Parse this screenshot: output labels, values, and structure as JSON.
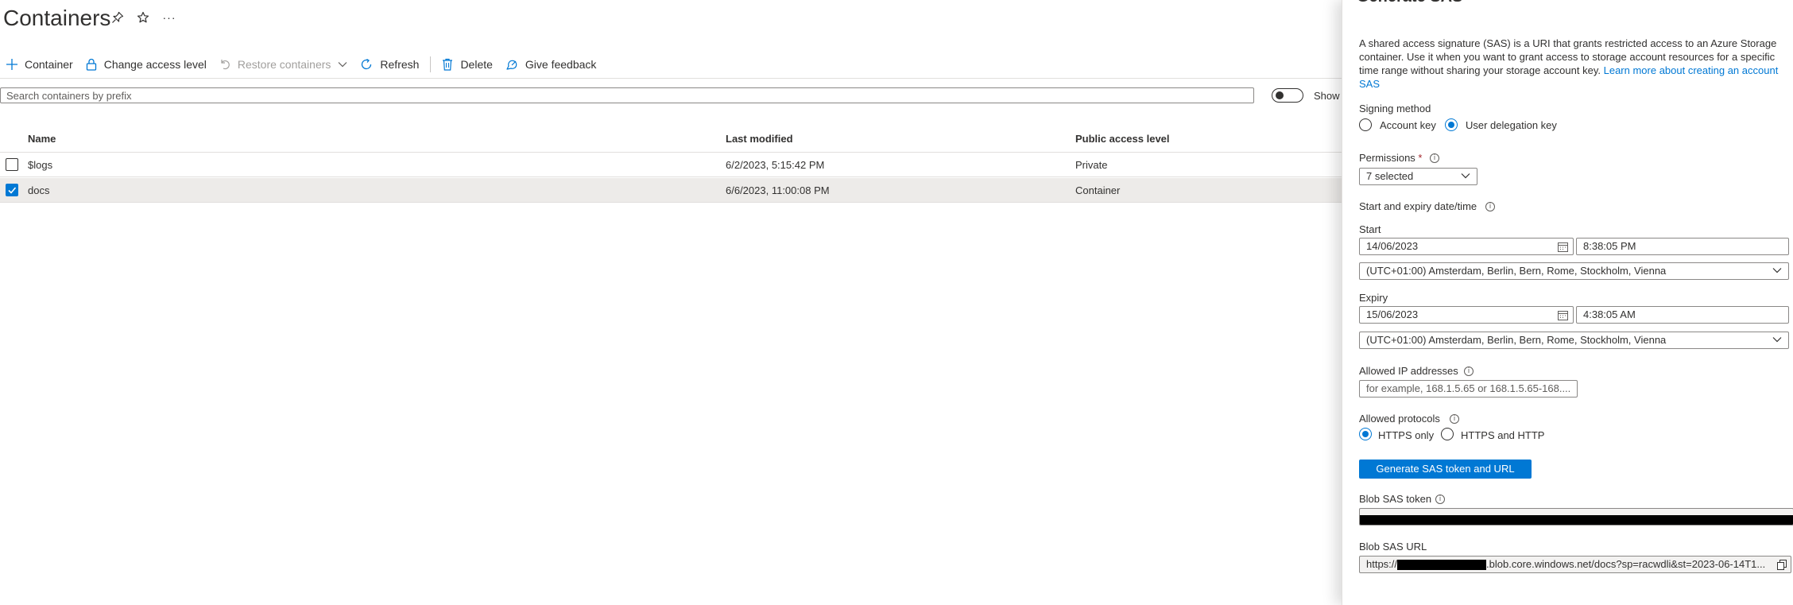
{
  "header": {
    "title": "Containers",
    "pin_icon": "pin-icon",
    "favorite_icon": "star-icon",
    "more_label": "···"
  },
  "toolbar": {
    "add_container": "Container",
    "change_access": "Change access level",
    "restore": "Restore containers",
    "refresh": "Refresh",
    "delete": "Delete",
    "feedback": "Give feedback"
  },
  "search": {
    "placeholder": "Search containers by prefix",
    "toggle_label": "Show"
  },
  "table": {
    "columns": [
      "Name",
      "Last modified",
      "Public access level"
    ],
    "rows": [
      {
        "name": "$logs",
        "modified": "6/2/2023, 5:15:42 PM",
        "access": "Private",
        "checked": false
      },
      {
        "name": "docs",
        "modified": "6/6/2023, 11:00:08 PM",
        "access": "Container",
        "checked": true
      }
    ]
  },
  "panel": {
    "title": "Generate SAS",
    "description": "A shared access signature (SAS) is a URI that grants restricted access to an Azure Storage container. Use it when you want to grant access to storage account resources for a specific time range without sharing your storage account key.",
    "learn_more": "Learn more about creating an account SAS",
    "signing_method": {
      "label": "Signing method",
      "options": [
        "Account key",
        "User delegation key"
      ],
      "selected": "User delegation key"
    },
    "permissions": {
      "label": "Permissions",
      "required_mark": "*",
      "value": "7 selected"
    },
    "dates_label": "Start and expiry date/time",
    "start": {
      "label": "Start",
      "date": "14/06/2023",
      "time": "8:38:05 PM",
      "timezone": "(UTC+01:00) Amsterdam, Berlin, Bern, Rome, Stockholm, Vienna"
    },
    "expiry": {
      "label": "Expiry",
      "date": "15/06/2023",
      "time": "4:38:05 AM",
      "timezone": "(UTC+01:00) Amsterdam, Berlin, Bern, Rome, Stockholm, Vienna"
    },
    "ip": {
      "label": "Allowed IP addresses",
      "placeholder": "for example, 168.1.5.65 or 168.1.5.65-168...."
    },
    "protocols": {
      "label": "Allowed protocols",
      "options": [
        "HTTPS only",
        "HTTPS and HTTP"
      ],
      "selected": "HTTPS only"
    },
    "generate_button": "Generate SAS token and URL",
    "token_label": "Blob SAS token",
    "url_label": "Blob SAS URL",
    "url_prefix": "https://",
    "url_suffix": ".blob.core.windows.net/docs?sp=racwdli&st=2023-06-14T1..."
  },
  "colors": {
    "accent": "#0078d4",
    "text": "#323130",
    "border": "#8a8886",
    "selected_row": "#edebe9"
  }
}
